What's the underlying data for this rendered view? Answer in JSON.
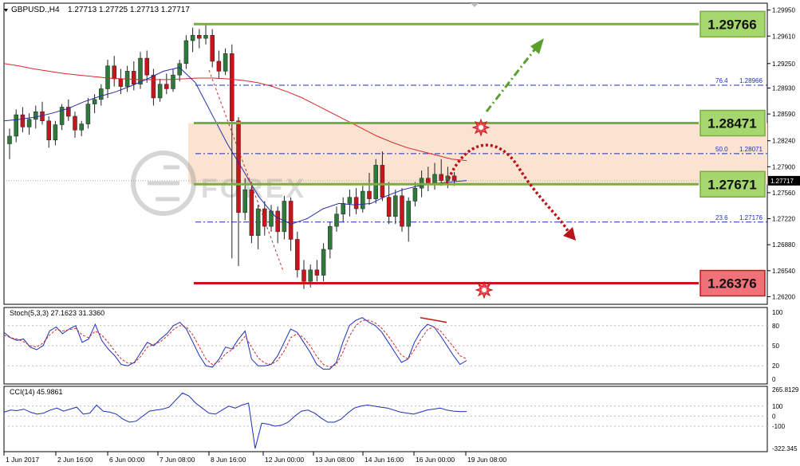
{
  "header": {
    "symbol": "GBPUSD.,H4",
    "ohlc": "1.27713 1.27725 1.27713 1.27717"
  },
  "watermark": "FOREX",
  "chart_data": {
    "type": "candlestick",
    "price_axis": {
      "ticks": [
        "1.29950",
        "1.29610",
        "1.29250",
        "1.28930",
        "1.28590",
        "1.28240",
        "1.27900",
        "1.27560",
        "1.27220",
        "1.26880",
        "1.26540",
        "1.26200"
      ],
      "current_price": "1.27717"
    },
    "time_axis": {
      "labels": [
        "1 Jun 2017",
        "2 Jun 16:00",
        "6 Jun 00:00",
        "7 Jun 08:00",
        "8 Jun 16:00",
        "12 Jun 00:00",
        "13 Jun 08:00",
        "14 Jun 16:00",
        "16 Jun 00:00",
        "19 Jun 08:00"
      ]
    },
    "levels": [
      {
        "label": "1.29766",
        "value": 1.29766,
        "color": "#79ad3f",
        "fill": "#a6d66e"
      },
      {
        "label": "1.28471",
        "value": 1.28471,
        "color": "#79ad3f",
        "fill": "#a6d66e"
      },
      {
        "label": "1.27671",
        "value": 1.27671,
        "color": "#79ad3f",
        "fill": "#a6d66e"
      },
      {
        "label": "1.26376",
        "value": 1.26376,
        "color": "#c8151b",
        "fill": "#f07178"
      }
    ],
    "fibonacci": [
      {
        "label": "76.4",
        "value_label": "1.28966",
        "value": 1.28966
      },
      {
        "label": "50.0",
        "value_label": "1.28071",
        "value": 1.28071
      },
      {
        "label": "23.6",
        "value_label": "1.27176",
        "value": 1.27176
      }
    ],
    "zone": {
      "from": 1.27671,
      "to": 1.28471,
      "color": "#fbe3d1"
    },
    "candles": [
      [
        1.282,
        1.284,
        1.28,
        1.283
      ],
      [
        1.283,
        1.2865,
        1.2822,
        1.2858
      ],
      [
        1.2858,
        1.2868,
        1.2835,
        1.2842
      ],
      [
        1.2842,
        1.286,
        1.2832,
        1.2852
      ],
      [
        1.2852,
        1.287,
        1.284,
        1.2862
      ],
      [
        1.2862,
        1.2875,
        1.2845,
        1.285
      ],
      [
        1.285,
        1.2856,
        1.2815,
        1.2825
      ],
      [
        1.2825,
        1.285,
        1.2818,
        1.2845
      ],
      [
        1.2845,
        1.2872,
        1.2838,
        1.2868
      ],
      [
        1.2868,
        1.2878,
        1.285,
        1.2856
      ],
      [
        1.2856,
        1.2862,
        1.2828,
        1.2838
      ],
      [
        1.2838,
        1.285,
        1.283,
        1.2846
      ],
      [
        1.2846,
        1.288,
        1.284,
        1.2872
      ],
      [
        1.2872,
        1.2885,
        1.286,
        1.2878
      ],
      [
        1.2878,
        1.2898,
        1.287,
        1.2892
      ],
      [
        1.2892,
        1.293,
        1.288,
        1.2922
      ],
      [
        1.2922,
        1.2935,
        1.2895,
        1.2905
      ],
      [
        1.2905,
        1.2918,
        1.2885,
        1.2895
      ],
      [
        1.2895,
        1.2922,
        1.2888,
        1.2915
      ],
      [
        1.2915,
        1.2928,
        1.289,
        1.2898
      ],
      [
        1.2898,
        1.294,
        1.2892,
        1.2932
      ],
      [
        1.2932,
        1.2942,
        1.29,
        1.291
      ],
      [
        1.291,
        1.2918,
        1.287,
        1.288
      ],
      [
        1.288,
        1.2905,
        1.2875,
        1.2898
      ],
      [
        1.2898,
        1.2912,
        1.2885,
        1.2892
      ],
      [
        1.2892,
        1.2918,
        1.2888,
        1.291
      ],
      [
        1.291,
        1.293,
        1.2902,
        1.2925
      ],
      [
        1.2925,
        1.2962,
        1.2918,
        1.2955
      ],
      [
        1.2955,
        1.2972,
        1.294,
        1.2962
      ],
      [
        1.2962,
        1.297,
        1.2945,
        1.2958
      ],
      [
        1.2958,
        1.2977,
        1.295,
        1.2962
      ],
      [
        1.2962,
        1.297,
        1.292,
        1.2928
      ],
      [
        1.2928,
        1.2942,
        1.2905,
        1.2915
      ],
      [
        1.2915,
        1.2945,
        1.291,
        1.2938
      ],
      [
        1.2938,
        1.295,
        1.267,
        1.285
      ],
      [
        1.285,
        1.2855,
        1.266,
        1.273
      ],
      [
        1.273,
        1.2775,
        1.272,
        1.276
      ],
      [
        1.276,
        1.277,
        1.269,
        1.27
      ],
      [
        1.27,
        1.274,
        1.2682,
        1.2735
      ],
      [
        1.2735,
        1.2745,
        1.27,
        1.2712
      ],
      [
        1.2712,
        1.274,
        1.2705,
        1.2732
      ],
      [
        1.2732,
        1.2738,
        1.269,
        1.2705
      ],
      [
        1.2705,
        1.2752,
        1.2695,
        1.2745
      ],
      [
        1.2745,
        1.275,
        1.268,
        1.2695
      ],
      [
        1.2695,
        1.2705,
        1.2645,
        1.2655
      ],
      [
        1.2655,
        1.2668,
        1.263,
        1.264
      ],
      [
        1.264,
        1.2662,
        1.2632,
        1.2655
      ],
      [
        1.2655,
        1.2668,
        1.264,
        1.2648
      ],
      [
        1.2648,
        1.269,
        1.264,
        1.2682
      ],
      [
        1.2682,
        1.2718,
        1.267,
        1.2712
      ],
      [
        1.2712,
        1.2738,
        1.2705,
        1.2728
      ],
      [
        1.2728,
        1.275,
        1.2718,
        1.2742
      ],
      [
        1.2742,
        1.276,
        1.2725,
        1.275
      ],
      [
        1.275,
        1.2762,
        1.2728,
        1.2735
      ],
      [
        1.2735,
        1.2765,
        1.273,
        1.2758
      ],
      [
        1.2758,
        1.2782,
        1.274,
        1.2748
      ],
      [
        1.2748,
        1.28,
        1.2742,
        1.2792
      ],
      [
        1.2792,
        1.281,
        1.2745,
        1.275
      ],
      [
        1.275,
        1.277,
        1.2715,
        1.2725
      ],
      [
        1.2725,
        1.276,
        1.2715,
        1.2752
      ],
      [
        1.2752,
        1.2762,
        1.2705,
        1.2712
      ],
      [
        1.2712,
        1.275,
        1.2692,
        1.2745
      ],
      [
        1.2745,
        1.277,
        1.2738,
        1.2762
      ],
      [
        1.2762,
        1.2785,
        1.275,
        1.2775
      ],
      [
        1.2775,
        1.279,
        1.2758,
        1.2768
      ],
      [
        1.2768,
        1.2795,
        1.276,
        1.278
      ],
      [
        1.278,
        1.28,
        1.2765,
        1.2772
      ],
      [
        1.2772,
        1.279,
        1.2762,
        1.2778
      ],
      [
        1.2778,
        1.2783,
        1.2765,
        1.2772
      ]
    ],
    "ma_slow": [
      1.2925,
      1.2922,
      1.2918,
      1.2915,
      1.2912,
      1.291,
      1.2908,
      1.2906,
      1.2905,
      1.2904,
      1.2904,
      1.2904,
      1.2905,
      1.2906,
      1.2906,
      1.2905,
      1.2903,
      1.29,
      1.2895,
      1.2888,
      1.288,
      1.287,
      1.286,
      1.285,
      1.284,
      1.283,
      1.2822,
      1.2815,
      1.281,
      1.2805,
      1.28,
      1.2798
    ],
    "ma_fast": [
      1.285,
      1.2852,
      1.2855,
      1.286,
      1.2866,
      1.2875,
      1.2882,
      1.2888,
      1.2896,
      1.2905,
      1.2915,
      1.292,
      1.29,
      1.286,
      1.282,
      1.2785,
      1.275,
      1.2725,
      1.2715,
      1.2722,
      1.2735,
      1.2742,
      1.274,
      1.2742,
      1.2752,
      1.276,
      1.2765,
      1.2768,
      1.277,
      1.2772
    ],
    "indicators": {
      "stoch": {
        "title": "Stoch(5,3,3) 27.1623 31.3360",
        "ticks": [
          "100",
          "80",
          "50",
          "20",
          "0"
        ],
        "main": [
          70,
          62,
          58,
          60,
          48,
          44,
          50,
          72,
          78,
          68,
          75,
          80,
          55,
          60,
          82,
          58,
          45,
          35,
          22,
          20,
          25,
          40,
          55,
          50,
          60,
          68,
          80,
          85,
          75,
          55,
          35,
          20,
          18,
          30,
          48,
          45,
          60,
          72,
          30,
          20,
          20,
          22,
          35,
          55,
          75,
          70,
          55,
          40,
          22,
          15,
          15,
          25,
          55,
          80,
          88,
          92,
          85,
          80,
          70,
          55,
          40,
          25,
          30,
          55,
          72,
          82,
          78,
          65,
          50,
          35,
          22,
          28
        ],
        "signal": [
          66,
          62,
          60,
          56,
          50,
          48,
          54,
          66,
          74,
          72,
          74,
          76,
          66,
          62,
          72,
          66,
          55,
          42,
          30,
          24,
          24,
          34,
          48,
          52,
          56,
          64,
          74,
          80,
          78,
          66,
          48,
          30,
          22,
          26,
          38,
          44,
          52,
          64,
          48,
          32,
          24,
          22,
          28,
          42,
          62,
          68,
          62,
          50,
          34,
          22,
          18,
          22,
          40,
          64,
          80,
          88,
          88,
          84,
          76,
          64,
          50,
          36,
          30,
          44,
          60,
          74,
          78,
          72,
          60,
          48,
          35,
          30
        ],
        "annotation": [
          [
            80,
            92
          ],
          [
            68,
            85
          ]
        ]
      },
      "cci": {
        "title": "CCI(14) 45.9861",
        "ticks": [
          "265.8129",
          "100",
          "0",
          "-100",
          "-322.345"
        ],
        "values": [
          40,
          60,
          55,
          70,
          40,
          20,
          30,
          60,
          80,
          50,
          70,
          90,
          20,
          30,
          110,
          50,
          40,
          20,
          -30,
          -60,
          -50,
          0,
          50,
          60,
          70,
          90,
          160,
          230,
          200,
          130,
          80,
          30,
          20,
          60,
          100,
          80,
          110,
          130,
          -10,
          -70,
          -80,
          -100,
          -90,
          -60,
          0,
          50,
          60,
          30,
          -20,
          -60,
          -60,
          -30,
          30,
          80,
          100,
          110,
          100,
          90,
          80,
          60,
          40,
          30,
          20,
          40,
          60,
          70,
          80,
          60,
          50,
          45,
          46
        ],
        "low_spike": -322
      }
    }
  }
}
